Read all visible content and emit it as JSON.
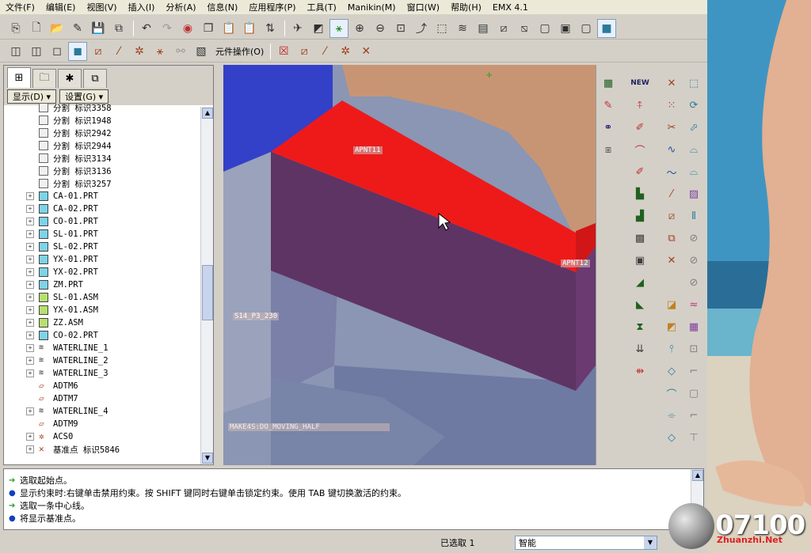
{
  "menu": [
    "文件(F)",
    "编辑(E)",
    "视图(V)",
    "插入(I)",
    "分析(A)",
    "信息(N)",
    "应用程序(P)",
    "工具(T)",
    "Manikin(M)",
    "窗口(W)",
    "帮助(H)",
    "EMX 4.1"
  ],
  "toolbar2": {
    "component_ops_label": "元件操作(O)"
  },
  "nav": {
    "display_button": "显示(D) ▾",
    "settings_button": "设置(G) ▾",
    "tree_items": [
      {
        "label": "分割 标识3358",
        "icon": "feature",
        "expand": false
      },
      {
        "label": "分割 标识1948",
        "icon": "feature",
        "expand": false
      },
      {
        "label": "分割 标识2942",
        "icon": "feature",
        "expand": false
      },
      {
        "label": "分割 标识2944",
        "icon": "feature",
        "expand": false
      },
      {
        "label": "分割 标识3134",
        "icon": "feature",
        "expand": false
      },
      {
        "label": "分割 标识3136",
        "icon": "feature",
        "expand": false
      },
      {
        "label": "分割 标识3257",
        "icon": "feature",
        "expand": false
      },
      {
        "label": "CA-01.PRT",
        "icon": "part",
        "expand": true
      },
      {
        "label": "CA-02.PRT",
        "icon": "part",
        "expand": true
      },
      {
        "label": "CO-01.PRT",
        "icon": "part",
        "expand": true
      },
      {
        "label": "SL-01.PRT",
        "icon": "part",
        "expand": true
      },
      {
        "label": "SL-02.PRT",
        "icon": "part",
        "expand": true
      },
      {
        "label": "YX-01.PRT",
        "icon": "part",
        "expand": true
      },
      {
        "label": "YX-02.PRT",
        "icon": "part",
        "expand": true
      },
      {
        "label": "ZM.PRT",
        "icon": "part",
        "expand": true
      },
      {
        "label": "SL-01.ASM",
        "icon": "assembly",
        "expand": true
      },
      {
        "label": "YX-01.ASM",
        "icon": "assembly",
        "expand": true
      },
      {
        "label": "ZZ.ASM",
        "icon": "assembly",
        "expand": true
      },
      {
        "label": "CO-02.PRT",
        "icon": "part",
        "expand": true
      },
      {
        "label": "WATERLINE_1",
        "icon": "waterline",
        "expand": true
      },
      {
        "label": "WATERLINE_2",
        "icon": "waterline",
        "expand": true
      },
      {
        "label": "WATERLINE_3",
        "icon": "waterline",
        "expand": true
      },
      {
        "label": "ADTM6",
        "icon": "plane",
        "expand": false
      },
      {
        "label": "ADTM7",
        "icon": "plane",
        "expand": false
      },
      {
        "label": "WATERLINE_4",
        "icon": "waterline",
        "expand": true
      },
      {
        "label": "ADTM9",
        "icon": "plane",
        "expand": false
      },
      {
        "label": "ACS0",
        "icon": "csys",
        "expand": true
      },
      {
        "label": "基准点 标识5846",
        "icon": "point",
        "expand": true
      }
    ]
  },
  "viewport": {
    "label_apnt11": "APNT11",
    "label_apnt12": "APNT12",
    "label_s14": "S14_P3_230",
    "label_moving": "MAKE4S:DO_MOVING_HALF"
  },
  "messages": [
    {
      "type": "prompt",
      "text": "选取起始点。"
    },
    {
      "type": "info",
      "text": "显示约束时:右键单击禁用约束。按 SHIFT 键同时右键单击锁定约束。使用 TAB 键切换激活的约束。"
    },
    {
      "type": "prompt",
      "text": "选取一条中心线。"
    },
    {
      "type": "info",
      "text": "将显示基准点。"
    }
  ],
  "status": {
    "selected": "已选取 1",
    "filter_value": "智能"
  },
  "watermark": {
    "number": "07100",
    "site": "Zhuanzhi.Net"
  }
}
